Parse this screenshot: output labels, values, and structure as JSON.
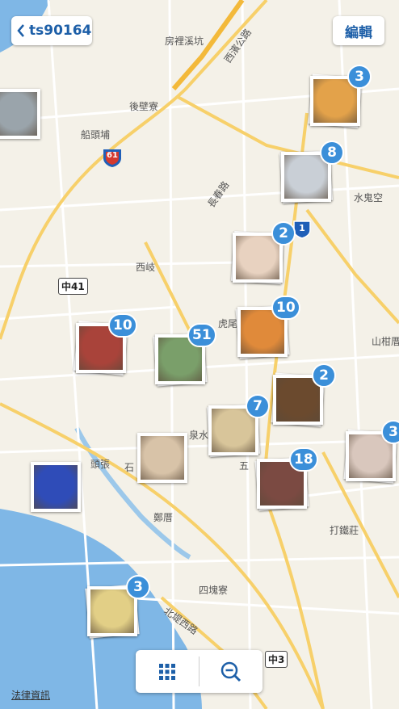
{
  "header": {
    "back_label": "ts90164",
    "edit_label": "編輯"
  },
  "map": {
    "places": [
      "房裡溪坑",
      "西濱公路",
      "後壁寮",
      "船頭埔",
      "長春路",
      "水鬼空",
      "西岐",
      "虎尾",
      "山柑厝",
      "頭張",
      "石",
      "泉水",
      "五",
      "鄭厝",
      "打鐵莊",
      "四塊寮",
      "北堤西路"
    ],
    "route_61": "61",
    "route_1": "1",
    "route_zhong41": "中41",
    "route_zhong3": "中3"
  },
  "pins": [
    {
      "name": "pin-fried-chicken",
      "count": "3",
      "color": "#e3a24a"
    },
    {
      "name": "pin-drinks",
      "count": "8",
      "color": "#c9cfd6"
    },
    {
      "name": "pin-baby",
      "count": "2",
      "color": "#e8d2c0"
    },
    {
      "name": "pin-fried-food",
      "count": "10",
      "color": "#e08a3a"
    },
    {
      "name": "pin-braised-pork",
      "count": "10",
      "color": "#a9433a"
    },
    {
      "name": "pin-hotpot",
      "count": "51",
      "color": "#7a9f6a"
    },
    {
      "name": "pin-braised-egg",
      "count": "2",
      "color": "#6b4a2e"
    },
    {
      "name": "pin-fish",
      "count": "7",
      "color": "#d8c59a"
    },
    {
      "name": "pin-sleeping-baby",
      "count": "3",
      "color": "#d9c7bd"
    },
    {
      "name": "pin-pudding",
      "count": "18",
      "color": "#7b4a42"
    },
    {
      "name": "pin-congee",
      "count": "",
      "color": "#d8c3a8"
    },
    {
      "name": "pin-tv",
      "count": "",
      "color": "#2f4cb8"
    },
    {
      "name": "pin-eggs",
      "count": "3",
      "color": "#e2cf86"
    },
    {
      "name": "pin-landscape",
      "count": "",
      "color": "#9aa4ab"
    }
  ],
  "toolbar": {
    "grid_icon": "grid-icon",
    "zoom_out_icon": "zoom-out-icon"
  },
  "legal_label": "法律資訊"
}
